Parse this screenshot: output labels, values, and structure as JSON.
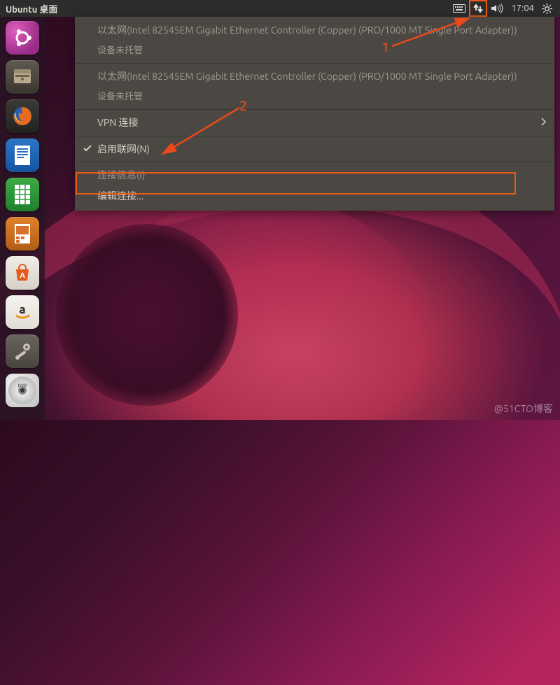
{
  "topbar": {
    "title": "Ubuntu 桌面",
    "time": "17:04",
    "indicators": {
      "keyboard": "keyboard-icon",
      "network": "network-icon",
      "sound": "sound-icon",
      "power": "power-icon"
    }
  },
  "launcher": {
    "items": [
      {
        "id": "dash",
        "label": "Dash"
      },
      {
        "id": "files",
        "label": "文件"
      },
      {
        "id": "firefox",
        "label": "Firefox"
      },
      {
        "id": "writer",
        "label": "LibreOffice Writer"
      },
      {
        "id": "calc",
        "label": "LibreOffice Calc"
      },
      {
        "id": "impress",
        "label": "LibreOffice Impress"
      },
      {
        "id": "software",
        "label": "Ubuntu 软件"
      },
      {
        "id": "amazon",
        "label": "Amazon"
      },
      {
        "id": "settings",
        "label": "系统设置"
      },
      {
        "id": "dvd",
        "label": "光盘"
      }
    ]
  },
  "network_menu": {
    "eth1_title": "以太网(Intel 82545EM Gigabit Ethernet Controller (Copper) (PRO/1000 MT Single Port Adapter))",
    "eth1_sub": "设备未托管",
    "eth2_title": "以太网(Intel 82545EM Gigabit Ethernet Controller (Copper) (PRO/1000 MT Single Port Adapter))",
    "eth2_sub": "设备未托管",
    "vpn": "VPN 连接",
    "enable_net": "启用联网(N)",
    "enable_net_checked": true,
    "conn_info": "连接信息(I)",
    "edit_conn": "编辑连接..."
  },
  "annotations": {
    "n1": "1",
    "n2": "2",
    "highlight_color": "#e65a1a"
  },
  "watermark": "@51CTO博客"
}
